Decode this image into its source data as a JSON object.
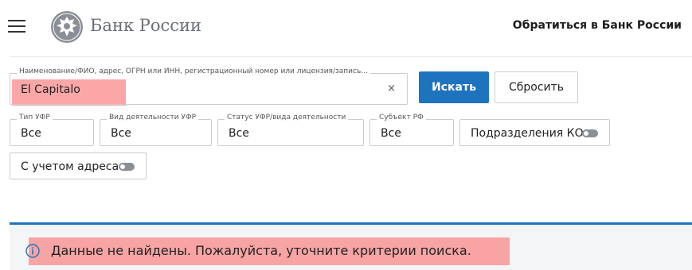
{
  "header": {
    "brand": "Банк России",
    "contact_link": "Обратиться в Банк России"
  },
  "search": {
    "legend": "Наименование/ФИО, адрес, ОГРН или ИНН, регистрационный номер или лицензия/запись...",
    "value": "El Capitalo",
    "clear_icon": "×",
    "search_label": "Искать",
    "reset_label": "Сбросить"
  },
  "filters": [
    {
      "legend": "Тип УФР",
      "value": "Все"
    },
    {
      "legend": "Вид деятельности УФР",
      "value": "Все"
    },
    {
      "legend": "Статус УФР/вида деятельности",
      "value": "Все"
    },
    {
      "legend": "Субъект РФ",
      "value": "Все"
    }
  ],
  "toggles": {
    "ko_divisions": {
      "label": "Подразделения КО",
      "on": false
    },
    "with_address": {
      "label": "С учетом адреса",
      "on": false
    }
  },
  "result": {
    "message": "Данные не найдены. Пожалуйста, уточните критерии поиска."
  },
  "colors": {
    "accent": "#1e73be",
    "highlight": "#fa8282",
    "border": "#c9ccd1"
  },
  "icons": [
    "menu-icon",
    "bank-emblem-icon",
    "clear-icon",
    "toggle-switch-icon",
    "info-icon"
  ]
}
